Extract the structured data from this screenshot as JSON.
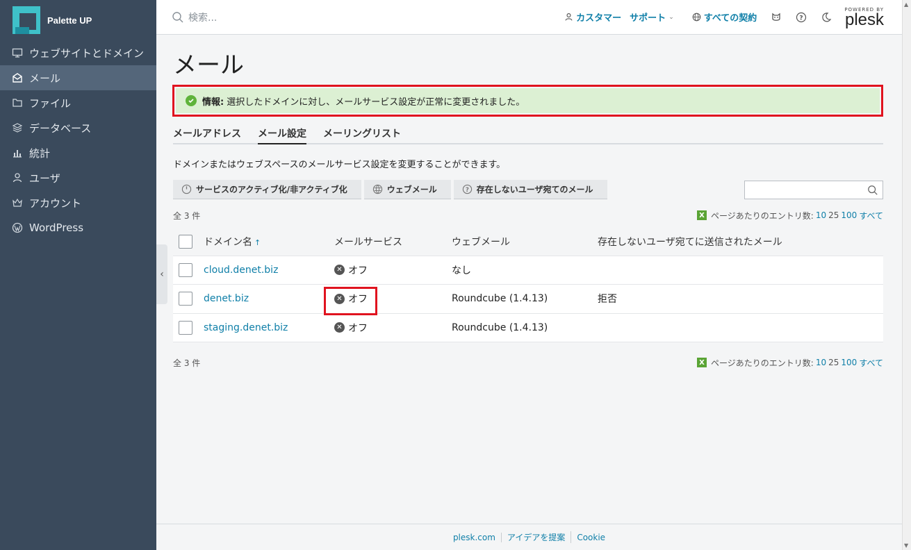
{
  "brand": {
    "name": "Palette UP"
  },
  "sidebar": {
    "items": [
      {
        "label": "ウェブサイトとドメイン",
        "icon": "monitor-icon"
      },
      {
        "label": "メール",
        "icon": "mail-icon",
        "active": true
      },
      {
        "label": "ファイル",
        "icon": "folder-icon"
      },
      {
        "label": "データベース",
        "icon": "database-icon"
      },
      {
        "label": "統計",
        "icon": "bar-chart-icon"
      },
      {
        "label": "ユーザ",
        "icon": "user-icon"
      },
      {
        "label": "アカウント",
        "icon": "crown-icon"
      },
      {
        "label": "WordPress",
        "icon": "wordpress-icon"
      }
    ]
  },
  "header": {
    "search_placeholder": "検索...",
    "customer_label": "カスタマー",
    "support_label": "サポート",
    "subscriptions_label": "すべての契約",
    "powered_by": "POWERED BY",
    "plesk": "plesk"
  },
  "page": {
    "title": "メール",
    "alert": {
      "label": "情報:",
      "message": "選択したドメインに対し、メールサービス設定が正常に変更されました。"
    },
    "tabs": [
      {
        "label": "メールアドレス"
      },
      {
        "label": "メール設定",
        "active": true
      },
      {
        "label": "メーリングリスト"
      }
    ],
    "description": "ドメインまたはウェブスペースのメールサービス設定を変更することができます。",
    "toolbar": {
      "activate_label": "サービスのアクティブ化/非アクティブ化",
      "webmail_label": "ウェブメール",
      "nonexistent_label": "存在しないユーザ宛てのメール",
      "search_value": ""
    },
    "list_info": {
      "total": "全 3 件",
      "entries_label": "ページあたりのエントリ数:",
      "page_sizes": [
        "10",
        "25",
        "100",
        "すべて"
      ]
    },
    "table": {
      "headers": {
        "domain": "ドメイン名",
        "mail_service": "メールサービス",
        "webmail": "ウェブメール",
        "nonexistent": "存在しないユーザ宛てに送信されたメール"
      },
      "rows": [
        {
          "domain": "cloud.denet.biz",
          "mail_service": "オフ",
          "webmail": "なし",
          "nonexistent": ""
        },
        {
          "domain": "denet.biz",
          "mail_service": "オフ",
          "webmail": "Roundcube (1.4.13)",
          "nonexistent": "拒否"
        },
        {
          "domain": "staging.denet.biz",
          "mail_service": "オフ",
          "webmail": "Roundcube (1.4.13)",
          "nonexistent": ""
        }
      ]
    }
  },
  "footer": {
    "links": [
      "plesk.com",
      "アイデアを提案",
      "Cookie"
    ]
  },
  "colors": {
    "sidebar_bg": "#3a4a5c",
    "link": "#0f7fa8",
    "alert_bg": "#dcf0d3",
    "highlight": "#e0131f"
  }
}
